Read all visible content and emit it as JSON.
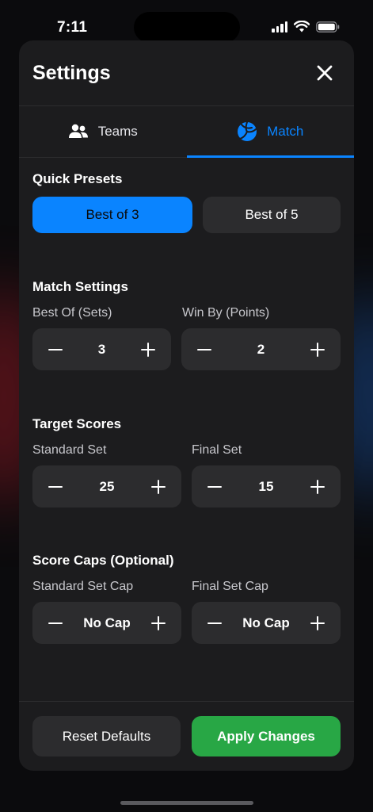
{
  "status_bar": {
    "time": "7:11"
  },
  "sheet": {
    "title": "Settings",
    "tabs": [
      {
        "label": "Teams",
        "icon": "people-icon",
        "active": false
      },
      {
        "label": "Match",
        "icon": "volleyball-icon",
        "active": true
      }
    ]
  },
  "quick_presets": {
    "title": "Quick Presets",
    "options": [
      {
        "label": "Best of 3",
        "selected": true
      },
      {
        "label": "Best of 5",
        "selected": false
      }
    ]
  },
  "match_settings": {
    "title": "Match Settings",
    "best_of": {
      "label": "Best Of (Sets)",
      "value": "3"
    },
    "win_by": {
      "label": "Win By (Points)",
      "value": "2"
    }
  },
  "target_scores": {
    "title": "Target Scores",
    "standard": {
      "label": "Standard Set",
      "value": "25"
    },
    "final": {
      "label": "Final Set",
      "value": "15"
    }
  },
  "score_caps": {
    "title": "Score Caps (Optional)",
    "standard": {
      "label": "Standard Set Cap",
      "value": "No Cap"
    },
    "final": {
      "label": "Final Set Cap",
      "value": "No Cap"
    }
  },
  "footer": {
    "reset_label": "Reset Defaults",
    "apply_label": "Apply Changes"
  },
  "colors": {
    "accent": "#0a84ff",
    "apply": "#28a745",
    "surface": "#1c1c1e",
    "control": "#2c2c2e"
  }
}
